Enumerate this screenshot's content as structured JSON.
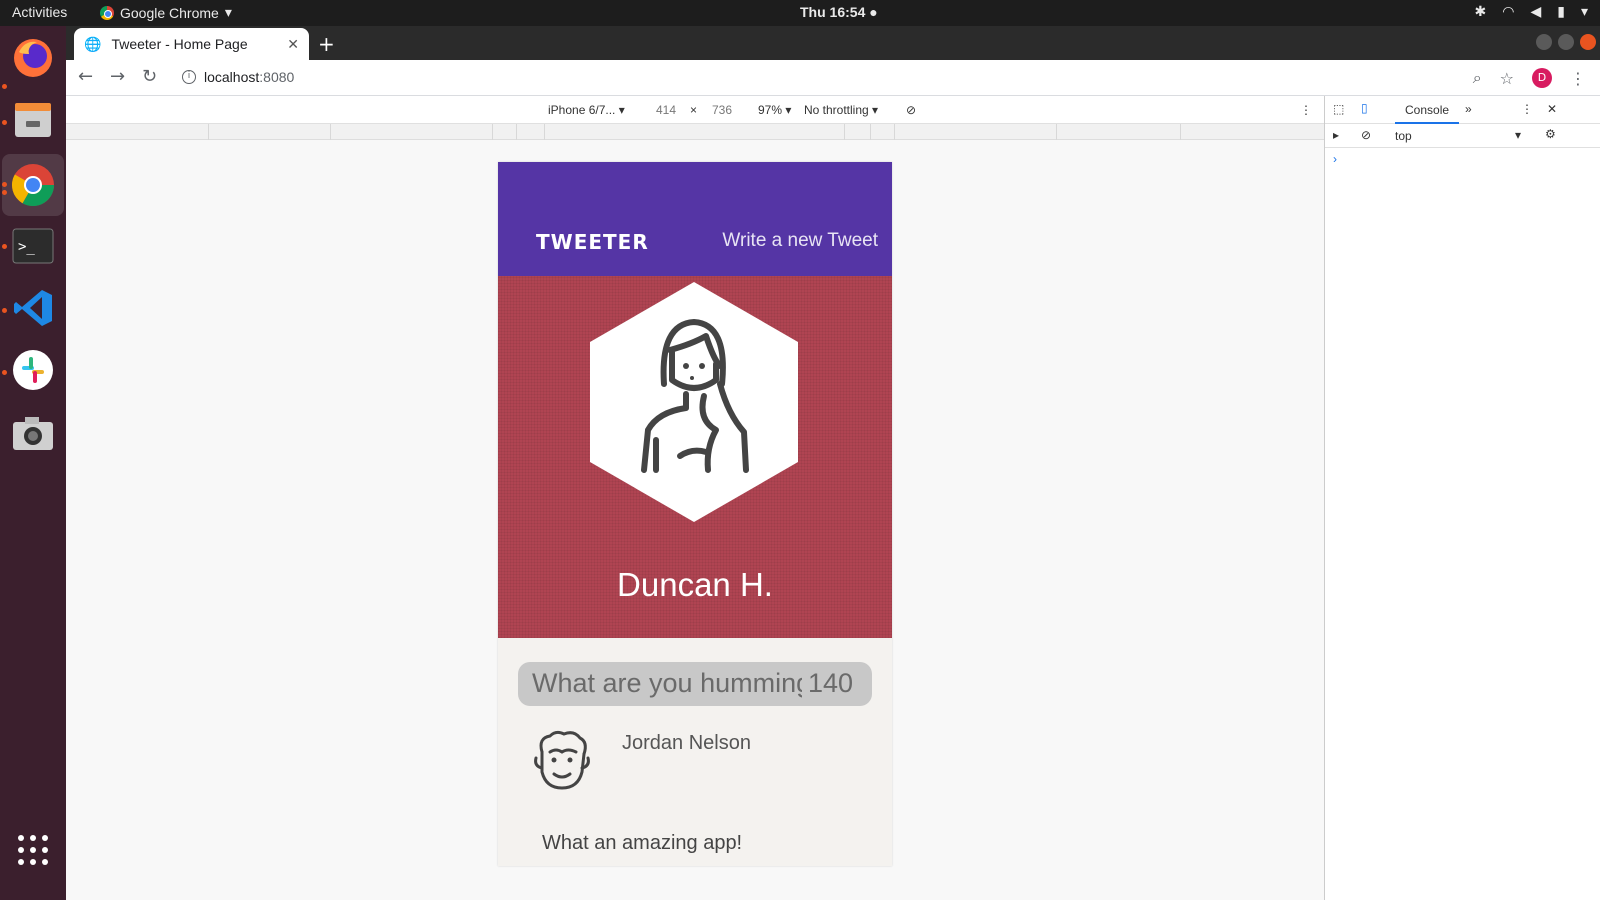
{
  "system": {
    "activities": "Activities",
    "app_name": "Google Chrome",
    "clock": "Thu 16:54 ●"
  },
  "browser": {
    "tab_title": "Tweeter - Home Page",
    "url_host": "localhost",
    "url_port": ":8080",
    "profile_initial": "D"
  },
  "device_toolbar": {
    "device": "iPhone 6/7... ▾",
    "width": "414",
    "times": "×",
    "height": "736",
    "zoom": "97% ▾",
    "throttling": "No throttling ▾"
  },
  "devtools": {
    "console_tab": "Console",
    "more_tabs": "»",
    "context": "top",
    "prompt": "›"
  },
  "app": {
    "brand": "TWEETER",
    "compose_link": "Write a new Tweet",
    "profile_name": "Duncan H.",
    "compose_placeholder": "What are you humming",
    "char_counter": "140",
    "tweets": [
      {
        "author": "Jordan Nelson",
        "text": "What an amazing app!"
      }
    ]
  },
  "colors": {
    "nav": "#5535a5",
    "profile_bg": "#b04452",
    "page_bg": "#f4f2ef",
    "dock": "#3b1f2d"
  }
}
